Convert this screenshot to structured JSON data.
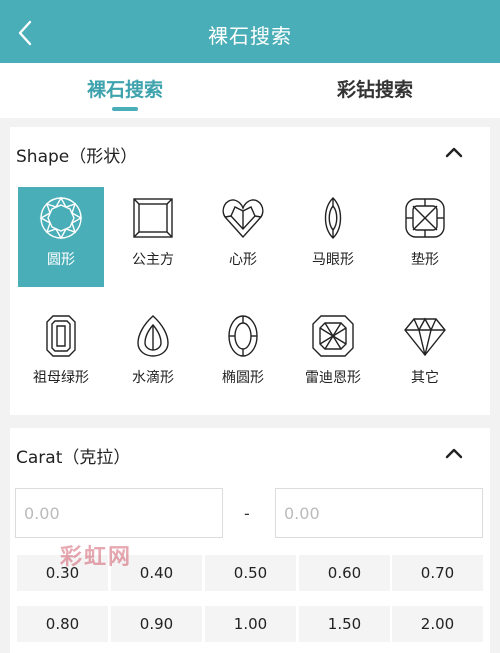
{
  "header": {
    "title": "裸石搜索",
    "back_icon": "chevron-left-icon",
    "background": "#4aaeb8"
  },
  "tabs": [
    {
      "label": "裸石搜索",
      "active": true
    },
    {
      "label": "彩钻搜索",
      "active": false
    }
  ],
  "shape_section": {
    "title": "Shape（形状）",
    "collapse_icon": "chevron-up-icon",
    "items": [
      {
        "label": "圆形",
        "icon": "round-diamond-icon",
        "selected": true
      },
      {
        "label": "公主方",
        "icon": "princess-diamond-icon",
        "selected": false
      },
      {
        "label": "心形",
        "icon": "heart-diamond-icon",
        "selected": false
      },
      {
        "label": "马眼形",
        "icon": "marquise-diamond-icon",
        "selected": false
      },
      {
        "label": "垫形",
        "icon": "cushion-diamond-icon",
        "selected": false
      },
      {
        "label": "祖母绿形",
        "icon": "emerald-diamond-icon",
        "selected": false
      },
      {
        "label": "水滴形",
        "icon": "pear-diamond-icon",
        "selected": false
      },
      {
        "label": "椭圆形",
        "icon": "oval-diamond-icon",
        "selected": false
      },
      {
        "label": "雷迪恩形",
        "icon": "radiant-diamond-icon",
        "selected": false
      },
      {
        "label": "其它",
        "icon": "other-diamond-icon",
        "selected": false
      }
    ]
  },
  "carat_section": {
    "title": "Carat（克拉）",
    "collapse_icon": "chevron-up-icon",
    "min_placeholder": "0.00",
    "max_placeholder": "0.00",
    "separator": "-",
    "presets": [
      "0.30",
      "0.40",
      "0.50",
      "0.60",
      "0.70",
      "0.80",
      "0.90",
      "1.00",
      "1.50",
      "2.00"
    ]
  },
  "watermark": "彩虹网",
  "accent_color": "#4aaeb8"
}
